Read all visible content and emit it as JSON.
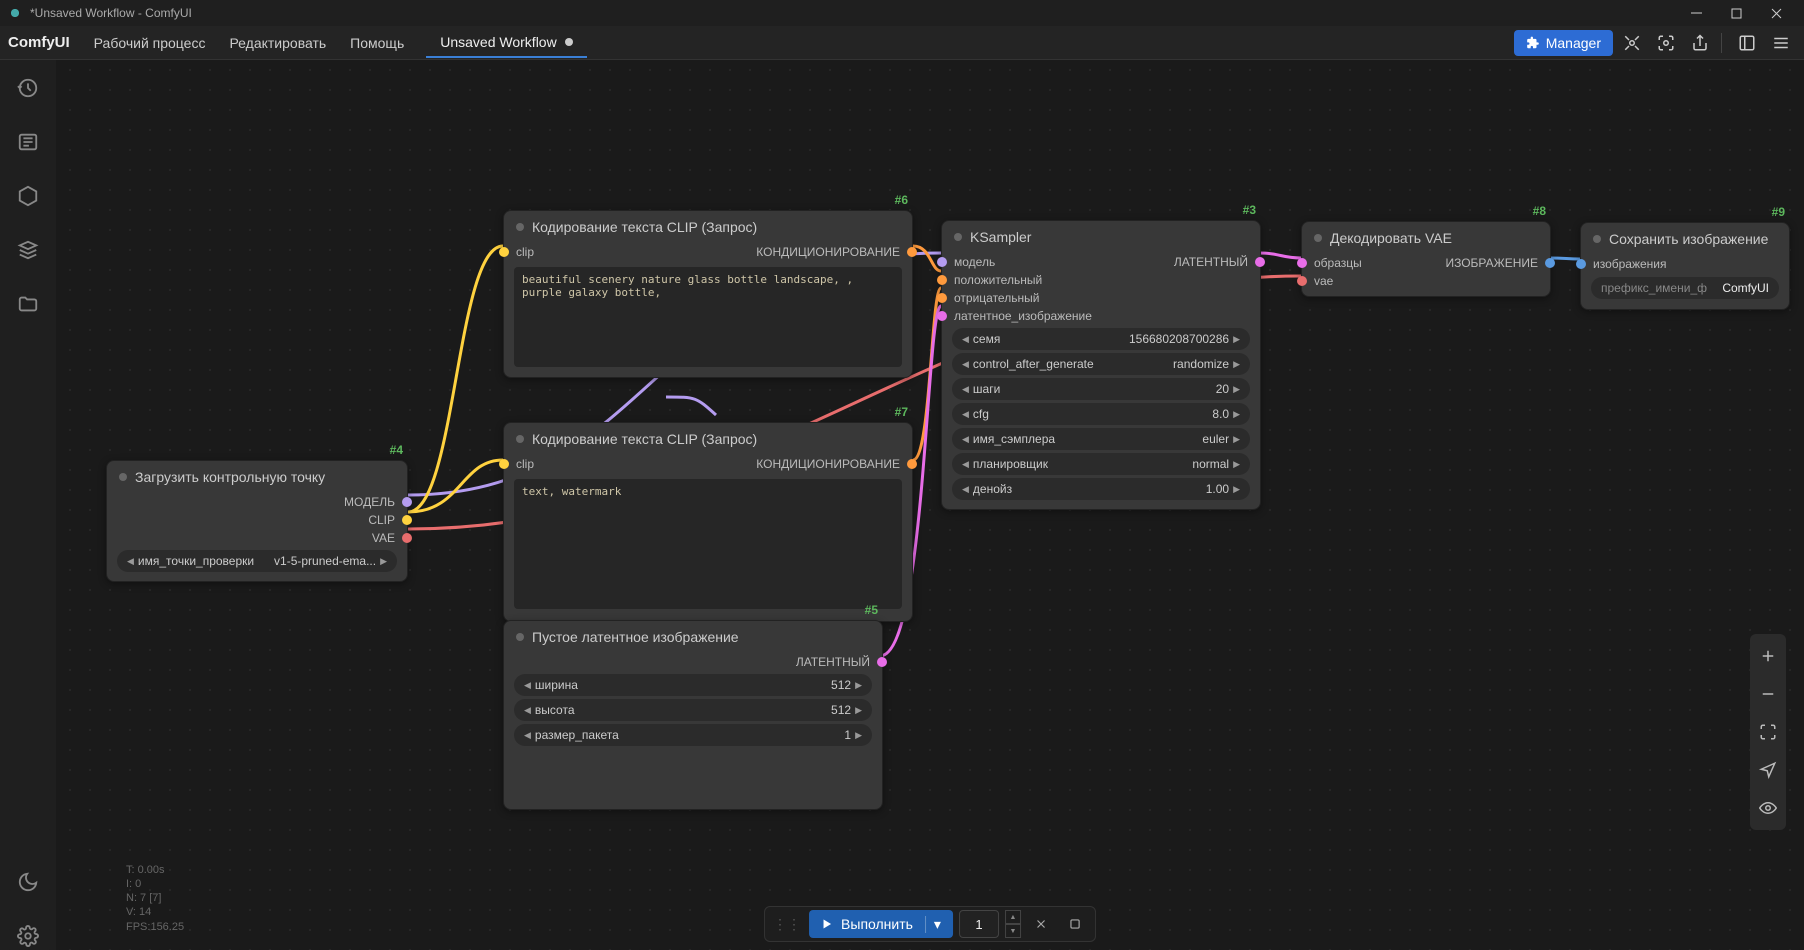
{
  "window": {
    "title": "*Unsaved Workflow - ComfyUI"
  },
  "menu": {
    "brand": "ComfyUI",
    "items": [
      "Рабочий процесс",
      "Редактировать",
      "Помощь"
    ],
    "tab": "Unsaved Workflow",
    "manager": "Manager"
  },
  "nodes": {
    "n4": {
      "id": "#4",
      "title": "Загрузить контрольную точку",
      "out": [
        "МОДЕЛЬ",
        "CLIP",
        "VAE"
      ],
      "widget": {
        "label": "имя_точки_проверки",
        "value": "v1-5-pruned-ema..."
      }
    },
    "n6": {
      "id": "#6",
      "title": "Кодирование текста CLIP (Запрос)",
      "in": "clip",
      "out": "КОНДИЦИОНИРОВАНИЕ",
      "text": "beautiful scenery nature glass bottle landscape, , purple galaxy bottle,"
    },
    "n7": {
      "id": "#7",
      "title": "Кодирование текста CLIP (Запрос)",
      "in": "clip",
      "out": "КОНДИЦИОНИРОВАНИЕ",
      "text": "text, watermark"
    },
    "n5": {
      "id": "#5",
      "title": "Пустое латентное изображение",
      "out": "ЛАТЕНТНЫЙ",
      "widgets": [
        {
          "label": "ширина",
          "value": "512"
        },
        {
          "label": "высота",
          "value": "512"
        },
        {
          "label": "размер_пакета",
          "value": "1"
        }
      ]
    },
    "n3": {
      "id": "#3",
      "title": "KSampler",
      "in": [
        "модель",
        "положительный",
        "отрицательный",
        "латентное_изображение"
      ],
      "out": "ЛАТЕНТНЫЙ",
      "widgets": [
        {
          "label": "семя",
          "value": "156680208700286"
        },
        {
          "label": "control_after_generate",
          "value": "randomize"
        },
        {
          "label": "шаги",
          "value": "20"
        },
        {
          "label": "cfg",
          "value": "8.0"
        },
        {
          "label": "имя_сэмплера",
          "value": "euler"
        },
        {
          "label": "планировщик",
          "value": "normal"
        },
        {
          "label": "денойз",
          "value": "1.00"
        }
      ]
    },
    "n8": {
      "id": "#8",
      "title": "Декодировать VAE",
      "in": [
        "образцы",
        "vae"
      ],
      "out": "ИЗОБРАЖЕНИЕ"
    },
    "n9": {
      "id": "#9",
      "title": "Сохранить изображение",
      "in": "изображения",
      "input": {
        "label": "префикс_имени_ф",
        "value": "ComfyUI"
      }
    }
  },
  "stats": [
    "T: 0.00s",
    "I: 0",
    "N: 7 [7]",
    "V: 14",
    "FPS:156.25"
  ],
  "action": {
    "run": "Выполнить",
    "count": "1"
  }
}
